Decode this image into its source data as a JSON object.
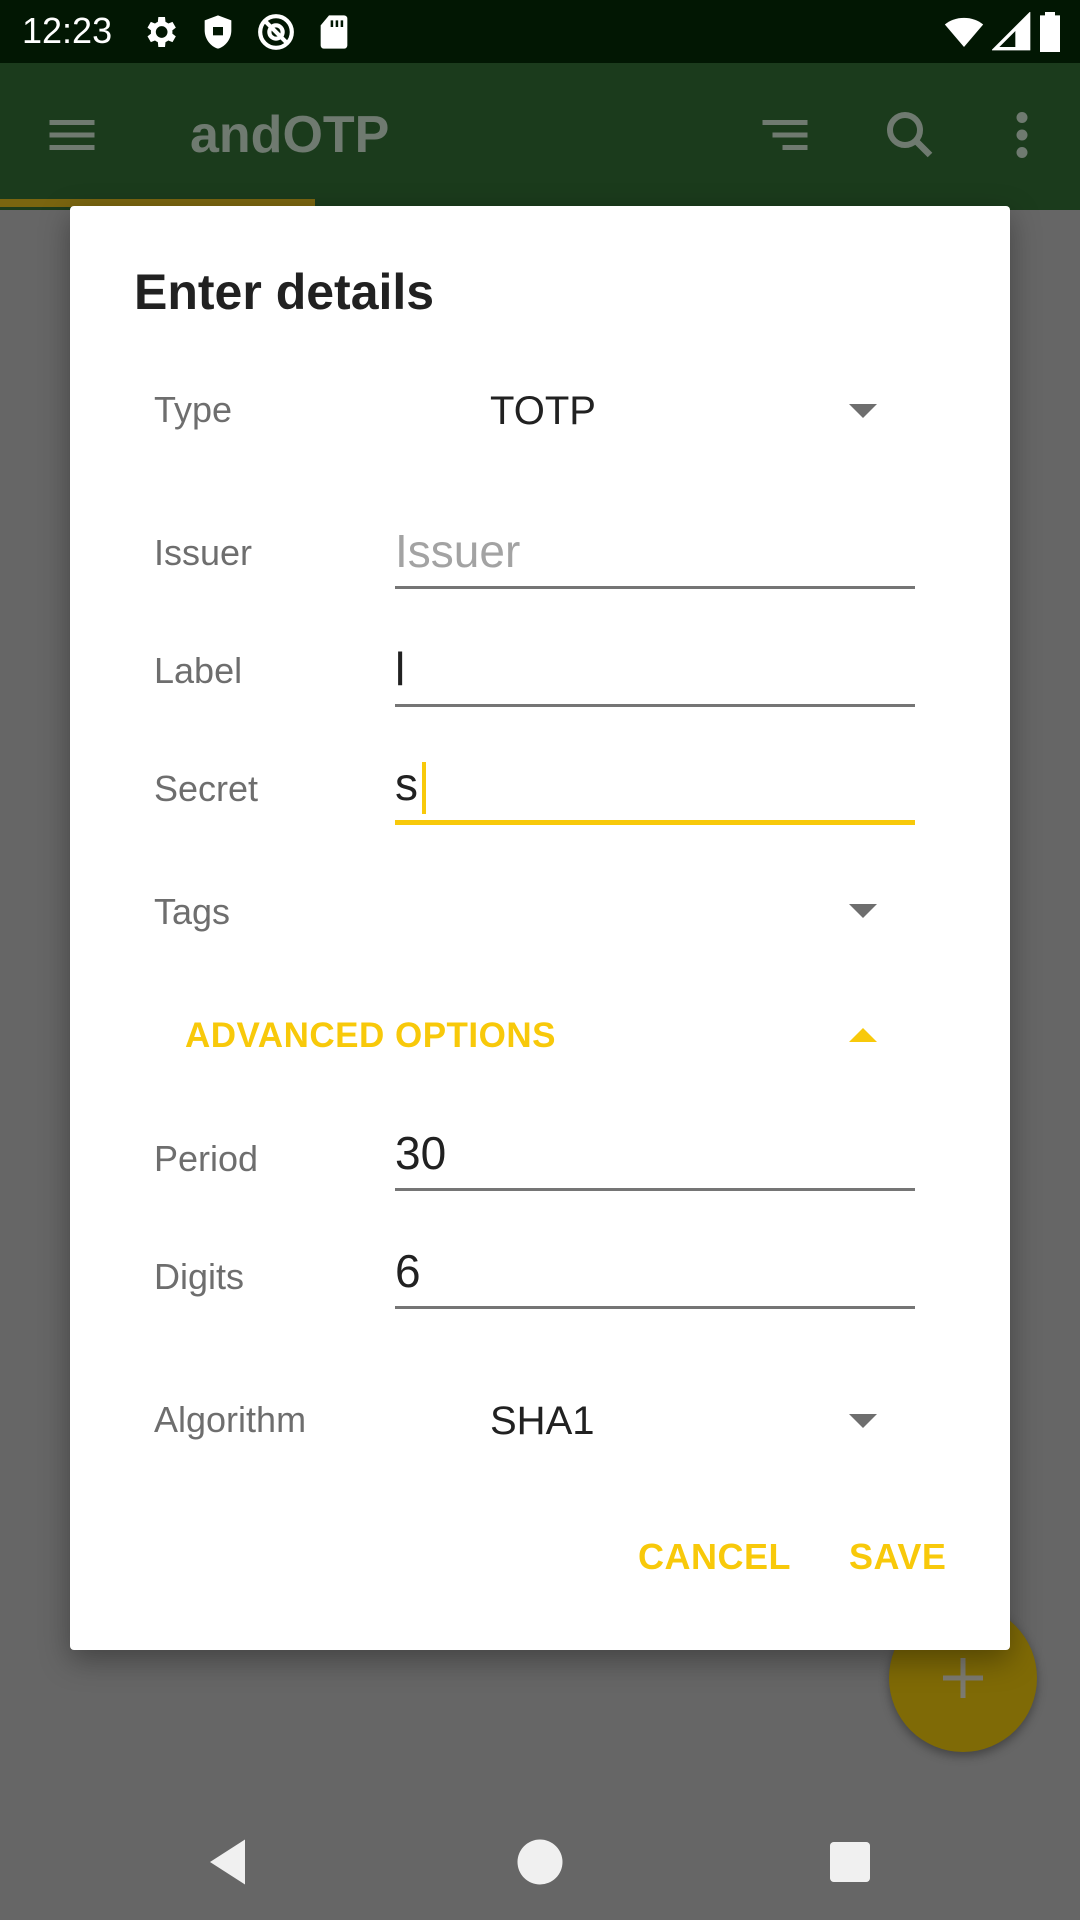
{
  "status_bar": {
    "time": "12:23",
    "left_icons": [
      "settings-icon",
      "shield-icon",
      "at-icon",
      "sd-card-icon"
    ],
    "right_icons": [
      "wifi-icon",
      "signal-icon",
      "battery-icon"
    ]
  },
  "toolbar": {
    "title": "andOTP",
    "icons": [
      "menu-icon",
      "sort-icon",
      "search-icon",
      "more-vert-icon"
    ]
  },
  "dialog": {
    "title": "Enter details",
    "type": {
      "label": "Type",
      "value": "TOTP"
    },
    "issuer": {
      "label": "Issuer",
      "placeholder": "Issuer",
      "value": ""
    },
    "label_field": {
      "label": "Label",
      "value": "l"
    },
    "secret": {
      "label": "Secret",
      "value": "s"
    },
    "tags": {
      "label": "Tags",
      "value": ""
    },
    "advanced_options": "ADVANCED OPTIONS",
    "period": {
      "label": "Period",
      "value": "30"
    },
    "digits": {
      "label": "Digits",
      "value": "6"
    },
    "algorithm": {
      "label": "Algorithm",
      "value": "SHA1"
    },
    "cancel_label": "CANCEL",
    "save_label": "SAVE"
  },
  "fab": {
    "icon": "add-icon"
  },
  "nav_bar": {
    "icons": [
      "back-icon",
      "home-icon",
      "recents-icon"
    ]
  },
  "colors": {
    "accent": "#f8c90a",
    "toolbar": "#1b3b1c",
    "status_bar": "#021703",
    "scrim_background": "#666666",
    "dialog_background": "#ffffff"
  }
}
